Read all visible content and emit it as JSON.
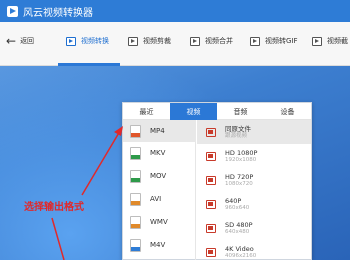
{
  "app": {
    "title": "风云视频转换器"
  },
  "toolbar": {
    "back_label": "返回",
    "tools": [
      {
        "label": "视频转换",
        "icon": "video-convert-icon",
        "active": true
      },
      {
        "label": "视频剪裁",
        "icon": "video-crop-icon",
        "active": false
      },
      {
        "label": "视频合并",
        "icon": "video-merge-icon",
        "active": false
      },
      {
        "label": "视频转GIF",
        "icon": "video-gif-icon",
        "active": false
      },
      {
        "label": "视频截",
        "icon": "video-screenshot-icon",
        "active": false
      }
    ]
  },
  "format_panel": {
    "tabs": [
      "最近",
      "视频",
      "音频",
      "设备"
    ],
    "active_tab": "视频",
    "formats": [
      {
        "name": "MP4",
        "color": "#e0562b",
        "selected": true
      },
      {
        "name": "MKV",
        "color": "#2e9a4a",
        "selected": false
      },
      {
        "name": "MOV",
        "color": "#2e9a4a",
        "selected": false
      },
      {
        "name": "AVI",
        "color": "#e08a2b",
        "selected": false
      },
      {
        "name": "WMV",
        "color": "#e08a2b",
        "selected": false
      },
      {
        "name": "M4V",
        "color": "#2e7cd6",
        "selected": false
      }
    ],
    "presets": [
      {
        "name": "同原文件",
        "sub": "跟源视频",
        "selected": true
      },
      {
        "name": "HD 1080P",
        "sub": "1920x1080",
        "selected": false
      },
      {
        "name": "HD 720P",
        "sub": "1080x720",
        "selected": false
      },
      {
        "name": "640P",
        "sub": "960x640",
        "selected": false
      },
      {
        "name": "SD 480P",
        "sub": "640x480",
        "selected": false
      },
      {
        "name": "4K Video",
        "sub": "4096x2160",
        "selected": false
      }
    ]
  },
  "annotation": {
    "text": "选择输出格式",
    "color": "#e0292b"
  }
}
